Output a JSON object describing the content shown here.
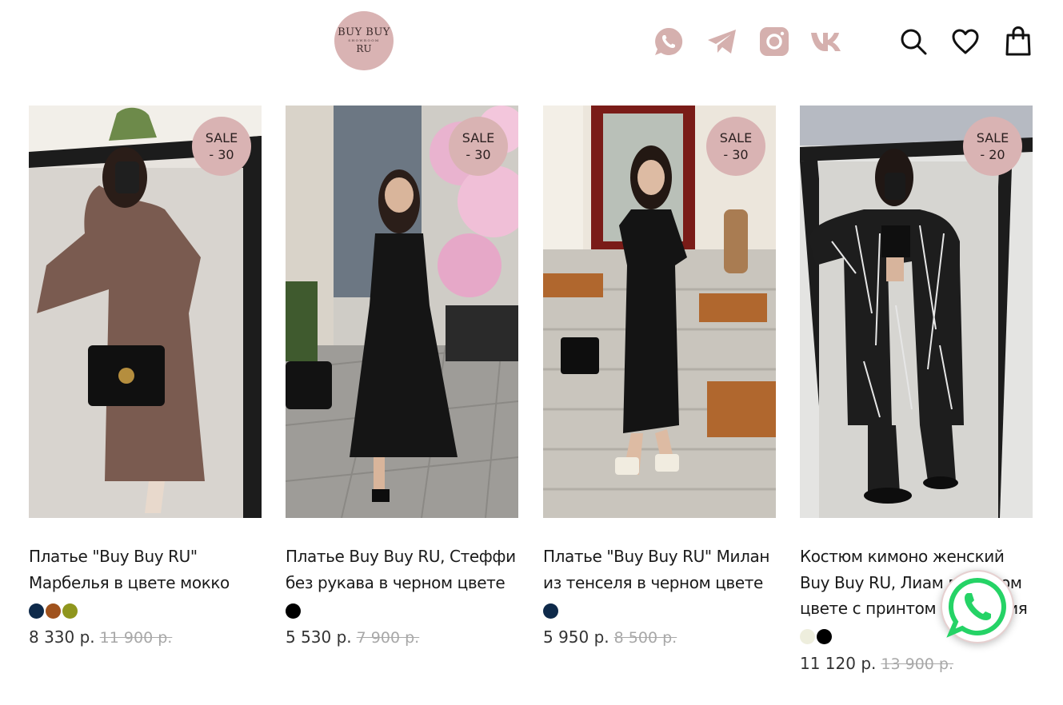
{
  "header": {
    "logo": {
      "line1": "BUY BUY",
      "line2": "SHOWROOM",
      "line3": "RU"
    },
    "social_icons": [
      "whatsapp-icon",
      "telegram-icon",
      "instagram-icon",
      "vk-icon"
    ],
    "action_icons": [
      "search-icon",
      "heart-icon",
      "bag-icon"
    ],
    "accent_color": "#d9b3b3"
  },
  "products": [
    {
      "badge_line1": "SALE",
      "badge_line2": "- 30",
      "title": "Платье \"Buy Buy RU\" Марбелья в цвете мокко",
      "swatches": [
        "#0e2a4a",
        "#a0521d",
        "#8f961d"
      ],
      "price": "8 330 р.",
      "old_price": "11 900 р."
    },
    {
      "badge_line1": "SALE",
      "badge_line2": "- 30",
      "title": "Платье Buy Buy RU, Стеффи без рукава в черном цвете",
      "swatches": [
        "#000000"
      ],
      "price": "5 530 р.",
      "old_price": "7 900 р."
    },
    {
      "badge_line1": "SALE",
      "badge_line2": "- 30",
      "title": "Платье \"Buy Buy RU\" Милан из тенселя в черном цвете",
      "swatches": [
        "#0e2a4a"
      ],
      "price": "5 950 р.",
      "old_price": "8 500 р."
    },
    {
      "badge_line1": "SALE",
      "badge_line2": "- 20",
      "title": "Костюм кимоно женский Buy Buy RU, Лиам в черном цвете с принтом геометрия",
      "swatches": [
        "#eeeedd",
        "#000000"
      ],
      "price": "11 120 р.",
      "old_price": "13 900 р."
    }
  ],
  "floating": {
    "icon": "whatsapp-icon",
    "color": "#25d366"
  }
}
